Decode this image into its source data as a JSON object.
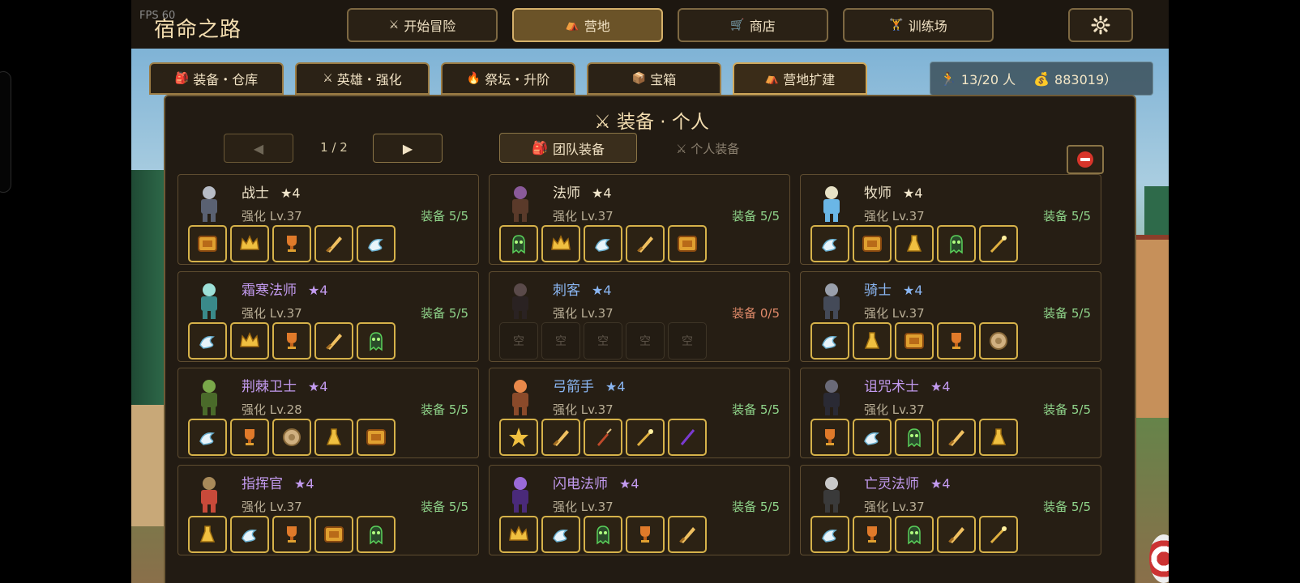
{
  "fps": "FPS 60",
  "game_title": "宿命之路",
  "nav": [
    {
      "label": "开始冒险",
      "icon": "crossed-swords-icon",
      "glyph": "⚔"
    },
    {
      "label": "营地",
      "icon": "tent-icon",
      "glyph": "⛺",
      "active": true
    },
    {
      "label": "商店",
      "icon": "cart-icon",
      "glyph": "🛒"
    },
    {
      "label": "训练场",
      "icon": "weightlifter-icon",
      "glyph": "🏋"
    }
  ],
  "settings_icon": "gear-icon",
  "subtabs": [
    {
      "label": "装备・仓库",
      "glyph": "🎒"
    },
    {
      "label": "英雄・强化",
      "glyph": "⚔"
    },
    {
      "label": "祭坛・升阶",
      "glyph": "🔥"
    },
    {
      "label": "宝箱",
      "glyph": "📦"
    },
    {
      "label": "营地扩建",
      "glyph": "⛺",
      "active": true
    }
  ],
  "resources": {
    "population": "13/20 人",
    "gold": "883019）"
  },
  "panel": {
    "title": "⚔ 装备 · 个人",
    "page": "1 / 2",
    "prev_glyph": "◀",
    "next_glyph": "▶",
    "team_tab": "团队装备",
    "personal_tab": "⚔ 个人装备"
  },
  "colors": {
    "gold_border": "#d6b24a",
    "purple_name": "#c39bf0",
    "blue_name": "#8ab6f2",
    "equip_green": "#8fd48a",
    "equip_empty": "#e08a6a"
  },
  "heroes": [
    {
      "name": "战士",
      "star": "★4",
      "rarity": "white",
      "level": "强化 Lv.37",
      "equip": "装备 5/5",
      "avatar": "knight",
      "slots": [
        "chest",
        "crown",
        "trophy",
        "sword",
        "boots"
      ]
    },
    {
      "name": "法师",
      "star": "★4",
      "rarity": "white",
      "level": "强化 Lv.37",
      "equip": "装备 5/5",
      "avatar": "wizard",
      "slots": [
        "ghost",
        "crown",
        "boots",
        "sword",
        "chest"
      ]
    },
    {
      "name": "牧师",
      "star": "★4",
      "rarity": "white",
      "level": "强化 Lv.37",
      "equip": "装备 5/5",
      "avatar": "priest",
      "slots": [
        "boots",
        "chest",
        "flask",
        "ghost",
        "staff"
      ]
    },
    {
      "name": "霜寒法师",
      "star": "★4",
      "rarity": "purple",
      "level": "强化 Lv.37",
      "equip": "装备 5/5",
      "avatar": "frost",
      "slots": [
        "boots",
        "crown",
        "trophy",
        "sword",
        "ghost"
      ]
    },
    {
      "name": "刺客",
      "star": "★4",
      "rarity": "blue",
      "level": "强化 Lv.37",
      "equip": "装备 0/5",
      "equip_empty": true,
      "avatar": "assassin",
      "slots": [
        "空",
        "空",
        "空",
        "空",
        "空"
      ]
    },
    {
      "name": "骑士",
      "star": "★4",
      "rarity": "blue",
      "level": "强化 Lv.37",
      "equip": "装备 5/5",
      "avatar": "paladin",
      "slots": [
        "boots",
        "flask",
        "chest",
        "trophy",
        "shield"
      ]
    },
    {
      "name": "荆棘卫士",
      "star": "★4",
      "rarity": "purple",
      "level": "强化 Lv.28",
      "equip": "装备 5/5",
      "avatar": "goblin",
      "slots": [
        "boots",
        "trophy",
        "shield",
        "flask",
        "chest"
      ]
    },
    {
      "name": "弓箭手",
      "star": "★4",
      "rarity": "blue",
      "level": "强化 Lv.37",
      "equip": "装备 5/5",
      "avatar": "archer",
      "slots": [
        "star",
        "sword",
        "dagger",
        "staff",
        "wand"
      ]
    },
    {
      "name": "诅咒术士",
      "star": "★4",
      "rarity": "purple",
      "level": "强化 Lv.37",
      "equip": "装备 5/5",
      "avatar": "warlock",
      "slots": [
        "trophy",
        "boots",
        "ghost",
        "sword",
        "flask"
      ]
    },
    {
      "name": "指挥官",
      "star": "★4",
      "rarity": "purple",
      "level": "强化 Lv.37",
      "equip": "装备 5/5",
      "avatar": "commander",
      "slots": [
        "flask",
        "boots",
        "trophy",
        "chest",
        "ghost"
      ]
    },
    {
      "name": "闪电法师",
      "star": "★4",
      "rarity": "purple",
      "level": "强化 Lv.37",
      "equip": "装备 5/5",
      "avatar": "lightning",
      "slots": [
        "crown",
        "boots",
        "ghost",
        "trophy",
        "sword"
      ]
    },
    {
      "name": "亡灵法师",
      "star": "★4",
      "rarity": "purple",
      "level": "强化 Lv.37",
      "equip": "装备 5/5",
      "avatar": "necro",
      "slots": [
        "boots",
        "trophy",
        "ghost",
        "sword",
        "staff"
      ]
    }
  ]
}
